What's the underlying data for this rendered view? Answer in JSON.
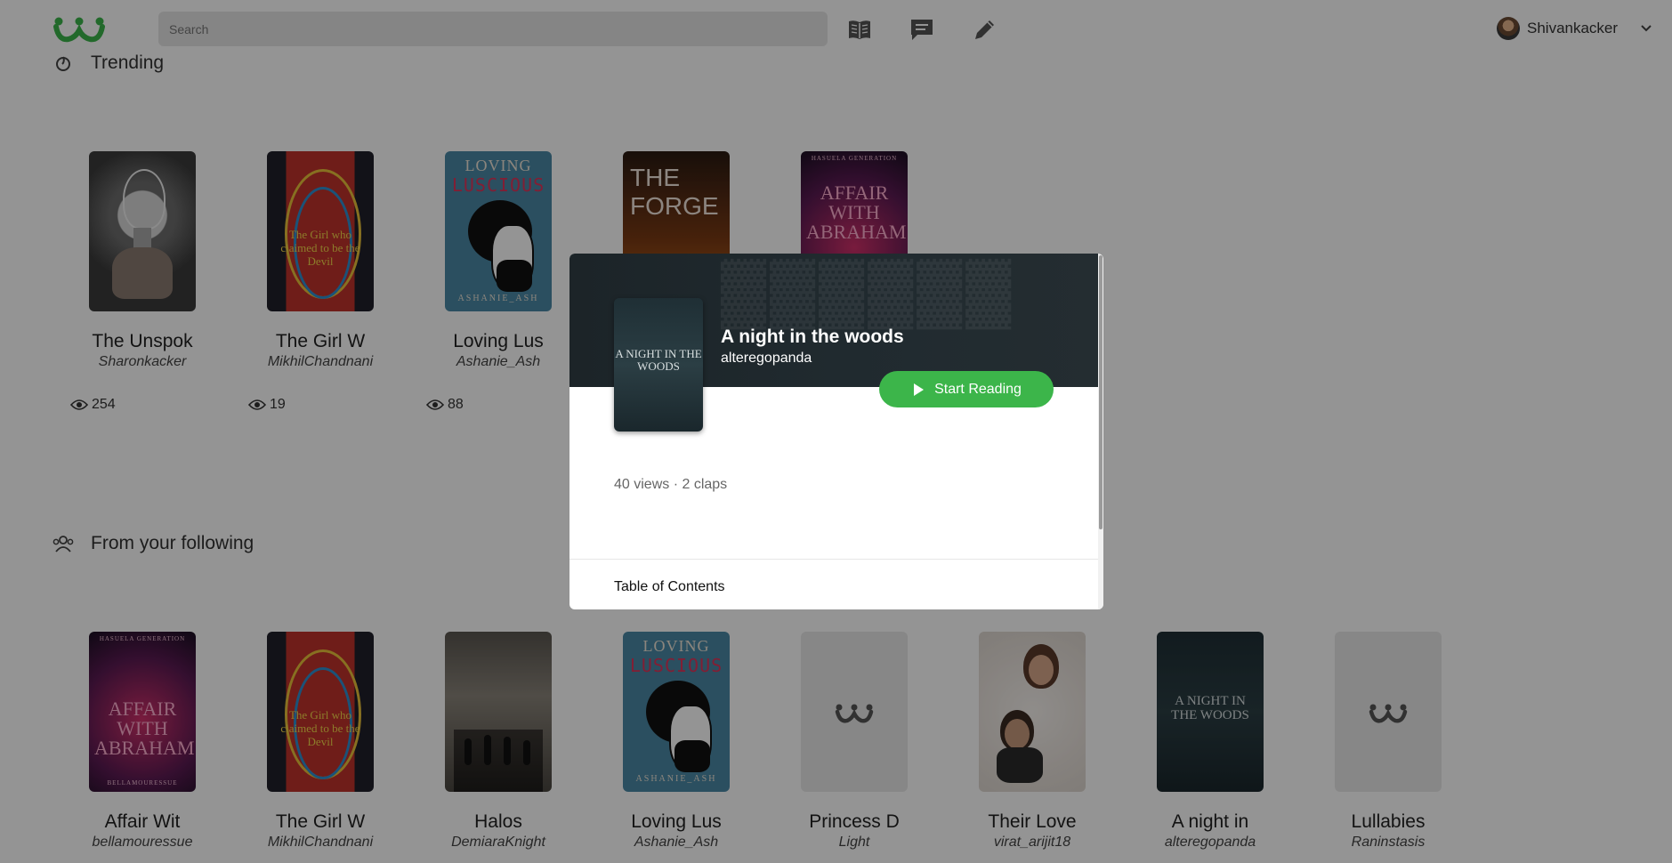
{
  "header": {
    "search_placeholder": "Search",
    "user_name": "Shivankacker",
    "accent_color": "#3cb54a"
  },
  "trending": {
    "title": "Trending",
    "books": [
      {
        "title": "The Unspok",
        "author": "Sharonkacker",
        "views": "254"
      },
      {
        "title": "The Girl W",
        "author": "MikhilChandnani",
        "views": "19",
        "cover_text": "The Girl who claimed to be the Devil"
      },
      {
        "title": "Loving Lus",
        "author": "Ashanie_Ash",
        "views": "88",
        "cover_top": "LOVING",
        "cover_main": "LUSCIOUS",
        "cover_bottom": "ASHANIE_ASH"
      },
      {
        "cover_text": "THE FORGE"
      },
      {
        "cover_top": "HASUELA GENERATION",
        "cover_text": "AFFAIR WITH ABRAHAM"
      }
    ]
  },
  "following": {
    "title": "From your following",
    "books": [
      {
        "title": "Affair Wit",
        "author": "bellamouressue",
        "cover_top": "HASUELA GENERATION",
        "cover_text": "AFFAIR WITH ABRAHAM",
        "cover_bottom": "BELLAMOURESSUE"
      },
      {
        "title": "The Girl W",
        "author": "MikhilChandnani",
        "cover_text": "The Girl who claimed to be the Devil"
      },
      {
        "title": "Halos",
        "author": "DemiaraKnight"
      },
      {
        "title": "Loving Lus",
        "author": "Ashanie_Ash",
        "cover_top": "LOVING",
        "cover_main": "LUSCIOUS",
        "cover_bottom": "ASHANIE_ASH"
      },
      {
        "title": "Princess D",
        "author": "Light"
      },
      {
        "title": "Their Love",
        "author": "virat_arijit18"
      },
      {
        "title": "A night in",
        "author": "alteregopanda",
        "cover_text": "A NIGHT IN THE WOODS"
      },
      {
        "title": "Lullabies",
        "author": "Raninstasis"
      }
    ]
  },
  "modal": {
    "title": "A night in the woods",
    "author": "alteregopanda",
    "cover_text": "A NIGHT IN THE WOODS",
    "start_label": "Start Reading",
    "stats": "40 views · 2 claps",
    "toc_label": "Table of Contents"
  }
}
